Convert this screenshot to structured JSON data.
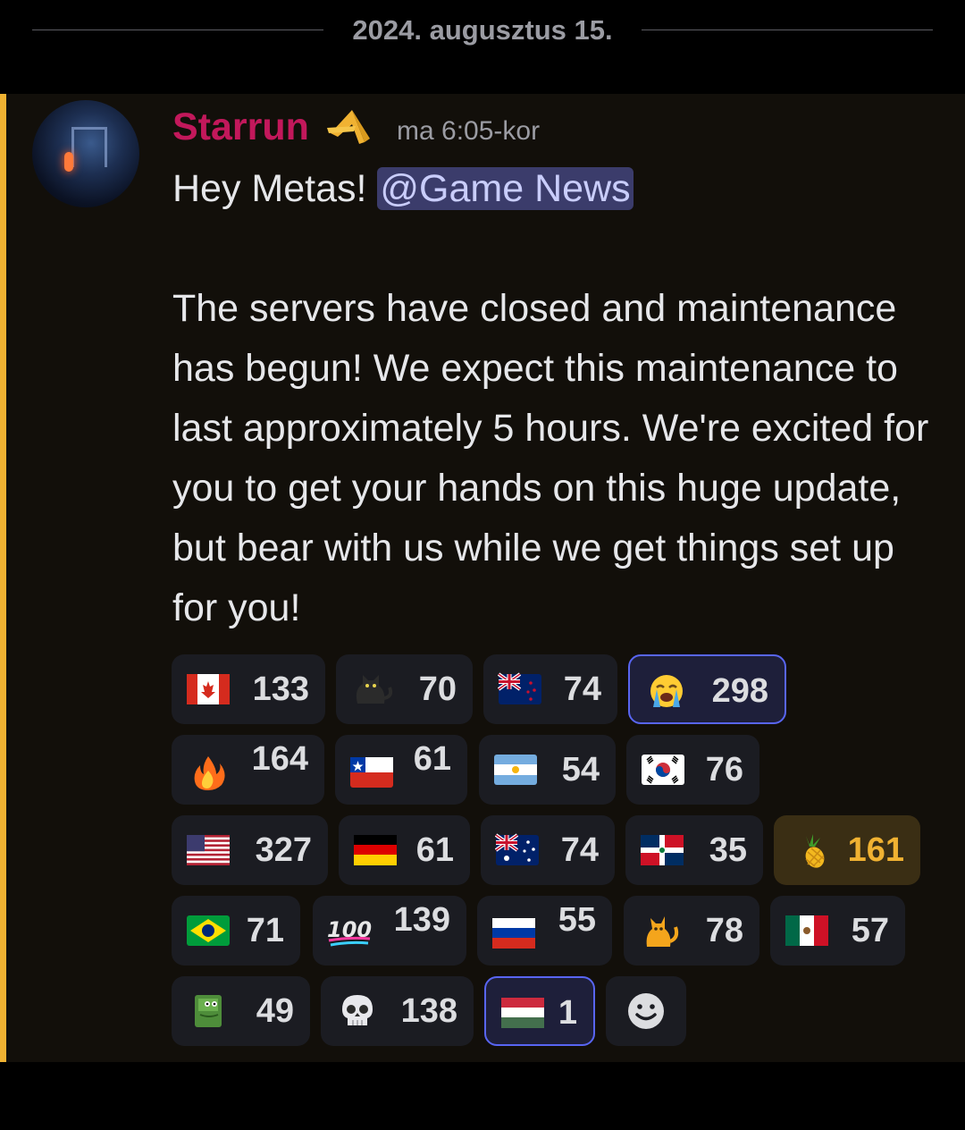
{
  "date_separator": "2024. augusztus 15.",
  "message": {
    "username": "Starrun",
    "username_color": "#c2185b",
    "badge_icon": "golden-a-badge",
    "timestamp": "ma 6:05-kor",
    "greeting": "Hey Metas! ",
    "mention": "@Game News",
    "body": "The servers have closed and maintenance has begun! We expect this maintenance to last approximately 5 hours. We're excited for you to get your hands on this huge update, but bear with us while we get things set up for you!"
  },
  "reactions": [
    {
      "emoji": "flag-canada",
      "count": "133"
    },
    {
      "emoji": "black-cat",
      "count": "70"
    },
    {
      "emoji": "flag-new-zealand",
      "count": "74"
    },
    {
      "emoji": "loudly-crying-face",
      "count": "298",
      "active": true
    },
    {
      "emoji": "fire",
      "count": "164"
    },
    {
      "emoji": "flag-chile",
      "count": "61"
    },
    {
      "emoji": "flag-argentina",
      "count": "54"
    },
    {
      "emoji": "flag-south-korea",
      "count": "76"
    },
    {
      "emoji": "flag-united-states",
      "count": "327"
    },
    {
      "emoji": "flag-germany",
      "count": "61"
    },
    {
      "emoji": "flag-australia",
      "count": "74"
    },
    {
      "emoji": "flag-dominican-republic",
      "count": "35"
    },
    {
      "emoji": "pineapple",
      "count": "161",
      "highlight": true
    },
    {
      "emoji": "flag-brazil",
      "count": "71"
    },
    {
      "emoji": "hundred-points",
      "count": "139"
    },
    {
      "emoji": "flag-russia",
      "count": "55"
    },
    {
      "emoji": "cat",
      "count": "78"
    },
    {
      "emoji": "flag-mexico",
      "count": "57"
    },
    {
      "emoji": "pepe-frog",
      "count": "49"
    },
    {
      "emoji": "skull",
      "count": "138"
    },
    {
      "emoji": "flag-hungary",
      "count": "1",
      "active": true
    },
    {
      "emoji": "add-reaction-smiley"
    }
  ],
  "colors": {
    "accent_bar": "#f0b232",
    "mention_bg": "#3b3c6b",
    "active_border": "#5865f2"
  }
}
